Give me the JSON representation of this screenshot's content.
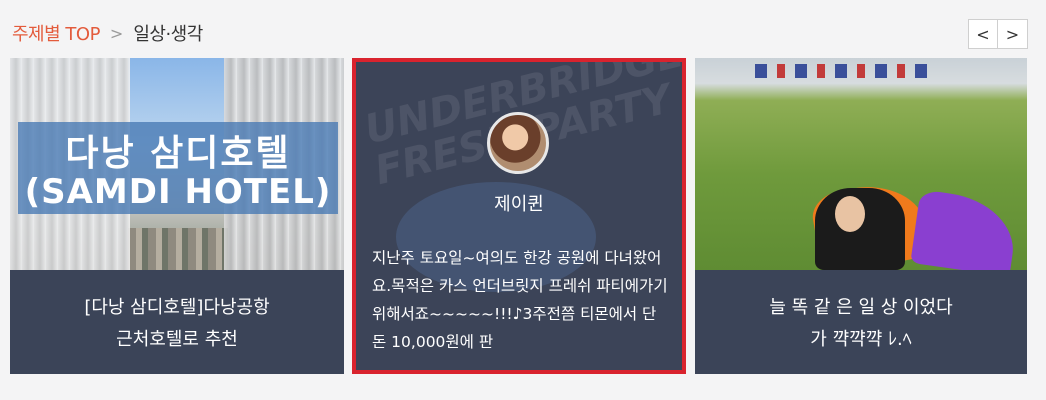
{
  "header": {
    "category": "주제별 TOP",
    "separator": ">",
    "current": "일상·생각",
    "prev_label": "<",
    "next_label": ">"
  },
  "cards": [
    {
      "image_text_line1": "다낭 삼디호텔",
      "image_text_line2": "(SAMDI HOTEL)",
      "caption_line1": "[다낭 삼디호텔]다낭공항",
      "caption_line2": "근처호텔로 추천"
    },
    {
      "author": "제이퀸",
      "watermark_line1": "UNDERBRIDGE",
      "watermark_line2": "FRESH PARTY",
      "excerpt": "지난주 토요일~여의도 한강 공원에 다녀왔어요.목적은 카스 언더브릿지 프레쉬 파티에가기 위해서죠~~~~~!!!♪3주전쯤 티몬에서 단돈 10,000원에 판"
    },
    {
      "caption_line1": "늘 똑 같 은 일 상 이었다",
      "caption_line2": "가 꺅꺅꺅 ﾚ.ﾍ"
    }
  ],
  "colors": {
    "accent": "#e35b3c",
    "selected_border": "#d9232e",
    "caption_bg": "#3b4458"
  }
}
